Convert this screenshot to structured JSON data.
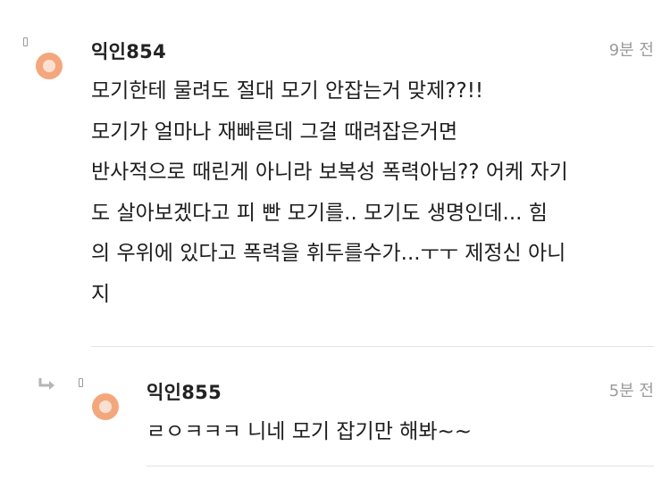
{
  "comments": [
    {
      "nickname": "익인854",
      "time": "9분 전",
      "lines": [
        "모기한테 물려도 절대 모기 안잡는거 맞제??!!",
        "모기가 얼마나 재빠른데 그걸 때려잡은거면",
        "반사적으로 때린게 아니라 보복성 폭력아님?? 어케 자기",
        "도 살아보겠다고 피 빤 모기를.. 모기도 생명인데... 힘",
        "의 우위에 있다고 폭력을 휘두를수가...ㅜㅜ 제정신 아니",
        "지"
      ]
    },
    {
      "nickname": "익인855",
      "time": "5분 전",
      "lines": [
        "ㄹㅇㅋㅋㅋ 니네 모기 잡기만 해봐~~"
      ]
    }
  ],
  "colors": {
    "avatar": "#f4a77c",
    "avatar_inner": "#fbe0d2",
    "time": "#9b9b9b",
    "divider": "#e3e3e3",
    "reply_arrow": "#b5b5b5"
  }
}
